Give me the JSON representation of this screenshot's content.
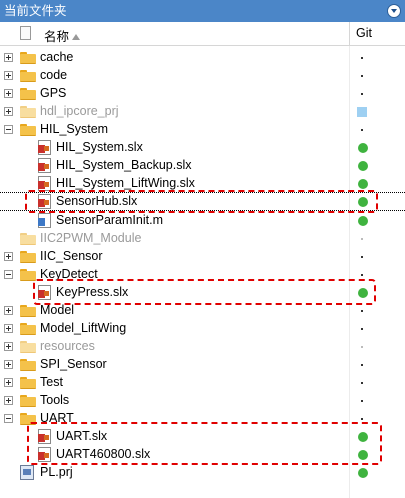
{
  "panel": {
    "title": "当前文件夹",
    "menu_icon": "circle-chevron-down-icon"
  },
  "header": {
    "name_label": "名称",
    "git_label": "Git"
  },
  "rows": [
    {
      "label": "cache",
      "type": "folder",
      "expander": "plus",
      "git": "dot",
      "dim": false
    },
    {
      "label": "code",
      "type": "folder",
      "expander": "plus",
      "git": "dot",
      "dim": false
    },
    {
      "label": "GPS",
      "type": "folder",
      "expander": "plus",
      "git": "dot",
      "dim": false
    },
    {
      "label": "hdl_ipcore_prj",
      "type": "folder",
      "expander": "plus",
      "git": "square",
      "dim": true
    },
    {
      "label": "HIL_System",
      "type": "folder",
      "expander": "minus",
      "git": "dot",
      "dim": false
    },
    {
      "label": "HIL_System.slx",
      "type": "slx",
      "expander": "",
      "git": "green",
      "dim": false
    },
    {
      "label": "HIL_System_Backup.slx",
      "type": "slx",
      "expander": "",
      "git": "green",
      "dim": false
    },
    {
      "label": "HIL_System_LiftWing.slx",
      "type": "slx",
      "expander": "",
      "git": "green",
      "dim": false
    },
    {
      "label": "SensorHub.slx",
      "type": "slx",
      "expander": "",
      "git": "green",
      "dim": false
    },
    {
      "label": "SensorParamInit.m",
      "type": "m",
      "expander": "",
      "git": "green",
      "dim": false
    },
    {
      "label": "IIC2PWM_Module",
      "type": "folder",
      "expander": "",
      "git": "dot-light",
      "dim": true
    },
    {
      "label": "IIC_Sensor",
      "type": "folder",
      "expander": "plus",
      "git": "dot",
      "dim": false
    },
    {
      "label": "KeyDetect",
      "type": "folder",
      "expander": "minus",
      "git": "dot",
      "dim": false
    },
    {
      "label": "KeyPress.slx",
      "type": "slx",
      "expander": "",
      "git": "green",
      "dim": false
    },
    {
      "label": "Model",
      "type": "folder",
      "expander": "plus",
      "git": "dot",
      "dim": false
    },
    {
      "label": "Model_LiftWing",
      "type": "folder",
      "expander": "plus",
      "git": "dot",
      "dim": false
    },
    {
      "label": "resources",
      "type": "folder",
      "expander": "plus",
      "git": "dot-light",
      "dim": true
    },
    {
      "label": "SPI_Sensor",
      "type": "folder",
      "expander": "plus",
      "git": "dot",
      "dim": false
    },
    {
      "label": "Test",
      "type": "folder",
      "expander": "plus",
      "git": "dot",
      "dim": false
    },
    {
      "label": "Tools",
      "type": "folder",
      "expander": "plus",
      "git": "dot",
      "dim": false
    },
    {
      "label": "UART",
      "type": "folder",
      "expander": "minus",
      "git": "dot",
      "dim": false
    },
    {
      "label": "UART.slx",
      "type": "slx",
      "expander": "",
      "git": "green",
      "dim": false
    },
    {
      "label": "UART460800.slx",
      "type": "slx",
      "expander": "",
      "git": "green",
      "dim": false
    },
    {
      "label": "PL.prj",
      "type": "prj",
      "expander": "",
      "git": "green",
      "dim": false
    }
  ],
  "colors": {
    "title_bar": "#4b86c8",
    "git_green": "#3fb33f",
    "highlight": "#e00000",
    "folder": "#f4c24a"
  }
}
